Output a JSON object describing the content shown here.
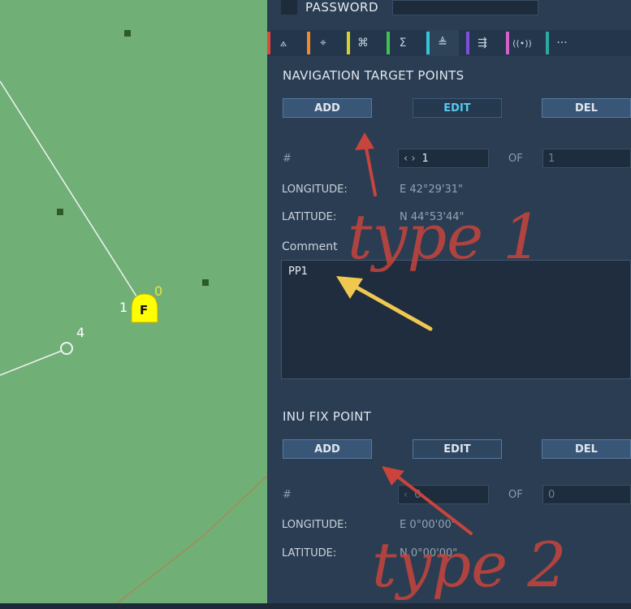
{
  "map": {
    "waypoint_labels": {
      "wp0": "0",
      "wp1": "1",
      "wp4": "4"
    },
    "marker_letter": "F",
    "colors": {
      "map_bg": "#70b077",
      "marker": "#ffff00"
    }
  },
  "header": {
    "password_label": "PASSWORD"
  },
  "tabs": [
    {
      "icon": "route-icon",
      "glyph": "⟑",
      "color": "#e0463c"
    },
    {
      "icon": "target-box-icon",
      "glyph": "⌖",
      "color": "#ef8b2c"
    },
    {
      "icon": "command-icon",
      "glyph": "⌘",
      "color": "#d6d12e"
    },
    {
      "icon": "sigma-icon",
      "glyph": "Σ",
      "color": "#3fc34e"
    },
    {
      "icon": "nav-points-icon",
      "glyph": "≜",
      "color": "#35c6d4"
    },
    {
      "icon": "data-transfer-icon",
      "glyph": "⇶",
      "color": "#7e4fd9"
    },
    {
      "icon": "radio-signal-icon",
      "glyph": "((•))",
      "color": "#d460c9"
    },
    {
      "icon": "more-icon",
      "glyph": "···",
      "color": "#2aa8a2"
    }
  ],
  "nav_target": {
    "title": "NAVIGATION TARGET POINTS",
    "add_label": "ADD",
    "edit_label": "EDIT",
    "del_label": "DEL",
    "index_label": "#",
    "index_value": "1",
    "of_label": "OF",
    "of_value": "1",
    "longitude_label": "LONGITUDE:",
    "longitude_value": "E 42°29'31\"",
    "latitude_label": "LATITUDE:",
    "latitude_value": "N 44°53'44\"",
    "comment_label": "Comment",
    "comment_value": "PP1"
  },
  "inu_fix": {
    "title": "INU FIX POINT",
    "add_label": "ADD",
    "edit_label": "EDIT",
    "del_label": "DEL",
    "index_label": "#",
    "index_value": "0",
    "of_label": "OF",
    "of_value": "0",
    "longitude_label": "LONGITUDE:",
    "longitude_value": "E  0°00'00\"",
    "latitude_label": "LATITUDE:",
    "latitude_value": "N  0°00'00\""
  },
  "annotations": {
    "type1": "type 1",
    "type2": "type 2",
    "colors": {
      "red": "#c8443c",
      "yellow": "#f0c850"
    }
  }
}
